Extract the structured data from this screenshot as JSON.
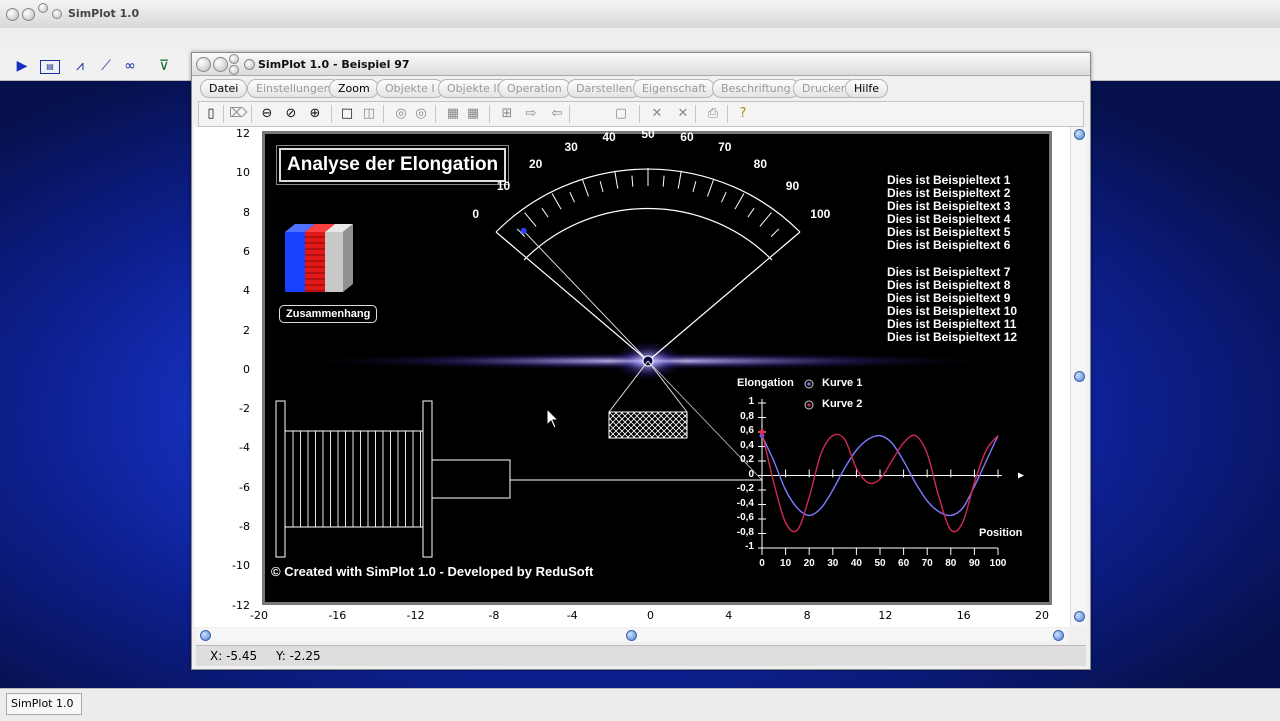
{
  "outer_window": {
    "title": "SimPlot 1.0"
  },
  "taskbar": {
    "item": "SimPlot 1.0"
  },
  "window": {
    "title": "SimPlot 1.0 - Beispiel 97"
  },
  "menu": [
    {
      "label": "Datei",
      "enabled": true
    },
    {
      "label": "Einstellungen",
      "enabled": false
    },
    {
      "label": "Zoom",
      "enabled": true
    },
    {
      "label": "Objekte I",
      "enabled": false
    },
    {
      "label": "Objekte II",
      "enabled": false
    },
    {
      "label": "Operation",
      "enabled": false
    },
    {
      "label": "Darstellen",
      "enabled": false
    },
    {
      "label": "Eigenschaft",
      "enabled": false
    },
    {
      "label": "Beschriftung",
      "enabled": false
    },
    {
      "label": "Drucken",
      "enabled": false
    },
    {
      "label": "Hilfe",
      "enabled": true
    }
  ],
  "toolbar_icons": [
    "pages-icon",
    "cursor-icon",
    "zoom-out-icon",
    "zoom-reset-icon",
    "zoom-in-icon",
    "square-icon",
    "double-square-icon",
    "circle-box-icon",
    "circle-box2-icon",
    "table-icon",
    "table-edit-icon",
    "copy-icon",
    "arrow-right-icon",
    "arrow-left-icon",
    "document-icon",
    "x-icon",
    "x2-icon",
    "print-icon",
    "help-icon"
  ],
  "plot": {
    "y_ticks": [
      "12",
      "10",
      "8",
      "6",
      "4",
      "2",
      "0",
      "-2",
      "-4",
      "-6",
      "-8",
      "-10",
      "-12"
    ],
    "x_ticks": [
      "-20",
      "-16",
      "-12",
      "-8",
      "-4",
      "0",
      "4",
      "8",
      "12",
      "16",
      "20"
    ]
  },
  "status": {
    "x": "X: -5.45",
    "y": "Y: -2.25"
  },
  "canvas": {
    "heading": "Analyse der Elongation",
    "button": "Zusammenhang",
    "gauge_labels": [
      "0",
      "10",
      "20",
      "30",
      "40",
      "50",
      "60",
      "70",
      "80",
      "90",
      "100"
    ],
    "gauge_value": 6,
    "texts_a": [
      "Dies ist Beispieltext 1",
      "Dies ist Beispieltext 2",
      "Dies ist Beispieltext 3",
      "Dies ist Beispieltext 4",
      "Dies ist Beispieltext 5",
      "Dies ist Beispieltext 6"
    ],
    "texts_b": [
      "Dies ist Beispieltext 7",
      "Dies ist Beispieltext 8",
      "Dies ist Beispieltext 9",
      "Dies ist Beispieltext 10",
      "Dies ist Beispieltext 11",
      "Dies ist Beispieltext 12"
    ],
    "credit": "© Created with SimPlot 1.0 - Developed by ReduSoft"
  },
  "chart_data": {
    "type": "line",
    "ylabel": "Elongation",
    "xlabel": "Position",
    "xlim": [
      0,
      100
    ],
    "ylim": [
      -1,
      1
    ],
    "x_ticks": [
      "0",
      "10",
      "20",
      "30",
      "40",
      "50",
      "60",
      "70",
      "80",
      "90",
      "100"
    ],
    "y_ticks": [
      "1",
      "0,8",
      "0,6",
      "0,4",
      "0,2",
      "0",
      "-0,2",
      "-0,4",
      "-0,6",
      "-0,8",
      "-1"
    ],
    "series": [
      {
        "name": "Kurve 1",
        "color": "#7a7aff",
        "x": [
          0,
          5,
          10,
          15,
          20,
          25,
          30,
          35,
          40,
          45,
          50,
          55,
          60,
          65,
          70,
          75,
          80,
          85,
          90,
          95,
          100
        ],
        "values": [
          0.55,
          0.2,
          -0.2,
          -0.45,
          -0.55,
          -0.45,
          -0.2,
          0.1,
          0.35,
          0.5,
          0.55,
          0.45,
          0.2,
          -0.1,
          -0.35,
          -0.5,
          -0.55,
          -0.45,
          -0.15,
          0.2,
          0.55
        ]
      },
      {
        "name": "Kurve 2",
        "color": "#d02a4e",
        "x": [
          0,
          5,
          10,
          15,
          20,
          25,
          30,
          35,
          40,
          45,
          50,
          55,
          60,
          65,
          70,
          75,
          80,
          85,
          90,
          95,
          100
        ],
        "values": [
          0.6,
          -0.1,
          -0.65,
          -0.75,
          -0.3,
          0.3,
          0.55,
          0.5,
          0.1,
          -0.1,
          -0.05,
          0.2,
          0.45,
          0.55,
          0.3,
          -0.3,
          -0.75,
          -0.65,
          -0.1,
          0.35,
          0.55
        ]
      }
    ]
  }
}
